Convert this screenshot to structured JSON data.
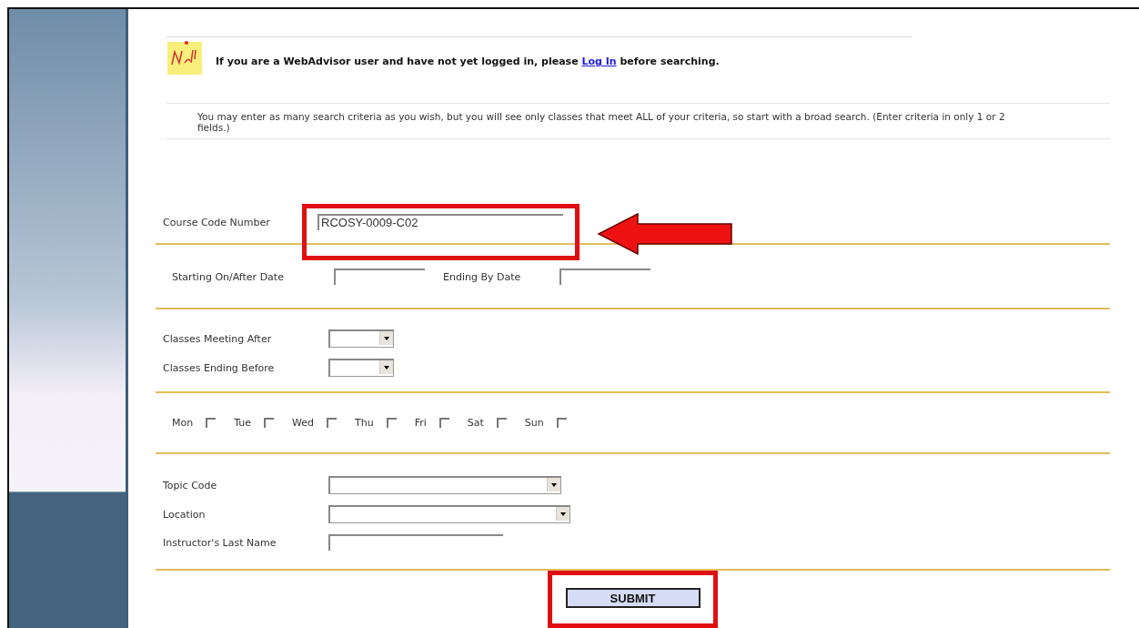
{
  "login_note": {
    "before": "If you are a WebAdvisor user and have not yet logged in, please",
    "link": "Log In",
    "after": "before searching."
  },
  "instructions": "You may enter as many search criteria as you wish, but you will see only classes that meet ALL of your criteria, so start with a broad search. (Enter criteria in only 1 or 2 fields.)",
  "course_code": {
    "label": "Course Code Number",
    "value": "RCOSY-0009-C02",
    "highlighted": true
  },
  "dates": [
    {
      "label": "Starting On/After Date"
    },
    {
      "label": "Ending By Date"
    }
  ],
  "times": [
    {
      "label": "Classes Meeting After"
    },
    {
      "label": "Classes Ending Before"
    }
  ],
  "days": [
    {
      "label": "Mon",
      "checked": false
    },
    {
      "label": "Tue",
      "checked": false
    },
    {
      "label": "Wed",
      "checked": false
    },
    {
      "label": "Thu",
      "checked": false
    },
    {
      "label": "Fri",
      "checked": false
    },
    {
      "label": "Sat",
      "checked": false
    },
    {
      "label": "Sun",
      "checked": false
    }
  ],
  "filters": [
    {
      "label": "Topic Code",
      "kind": "select"
    },
    {
      "label": "Location",
      "kind": "select"
    },
    {
      "label": "Instructor's Last Name",
      "kind": "text"
    }
  ],
  "submit": {
    "label": "SUBMIT",
    "highlighted": true
  }
}
